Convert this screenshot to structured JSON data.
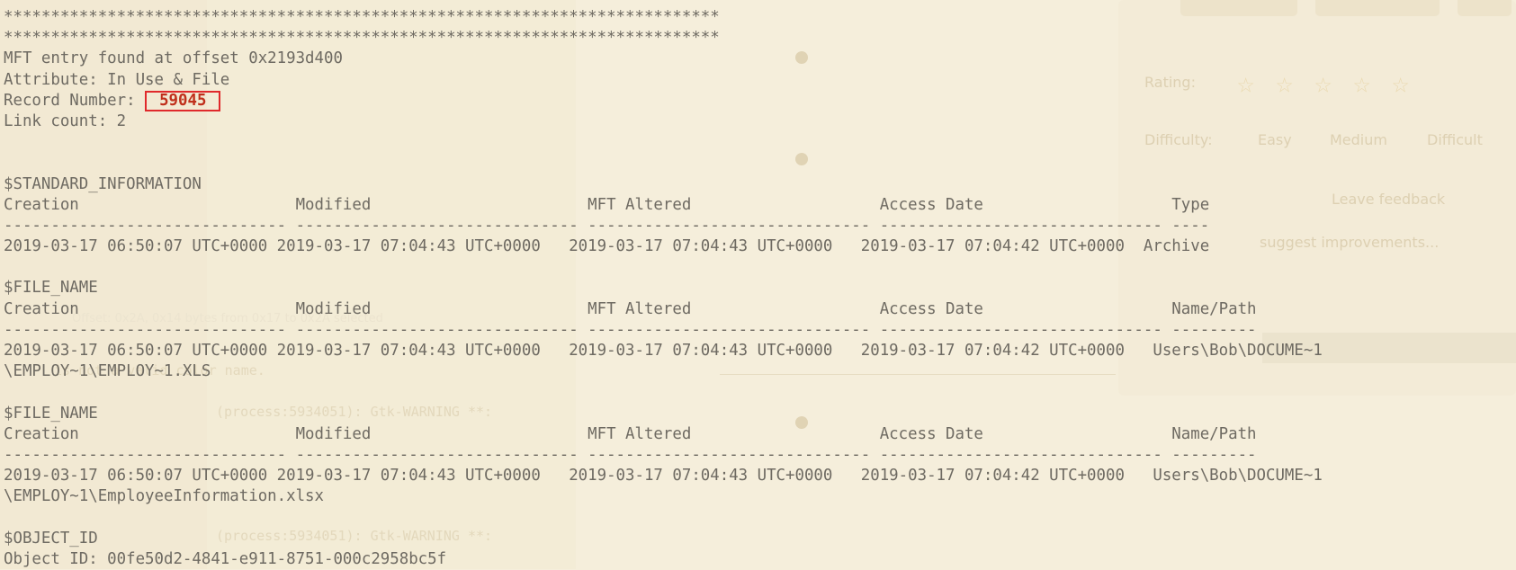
{
  "background": {
    "rating_label": "Rating:",
    "difficulty_label": "Difficulty:",
    "difficulty_options": [
      "Easy",
      "Medium",
      "Difficult"
    ],
    "feedback_text": "Leave feedback",
    "suggest_text": "suggest improvements...",
    "offset_status": "Offset: 0x2A, 0x14 bytes from 0x17 to 0x2A selected",
    "gtk_warning": "(process:5934051): Gtk-WARNING **:",
    "color_name_note": "is not a valid color name.",
    "colors": {
      "background": "#f5eedb",
      "text": "#6e6a62",
      "highlight_border": "#e0292b",
      "highlight_text": "#c0301c"
    }
  },
  "terminal": {
    "separator": "****************************************************************************",
    "entry_found": "MFT entry found at offset 0x2193d400",
    "attribute": "Attribute: In Use & File",
    "record_label": "Record Number: ",
    "record_number": "59045",
    "link_count": "Link count: 2",
    "std_info": {
      "title": "$STANDARD_INFORMATION",
      "header": "Creation                       Modified                       MFT Altered                    Access Date                    Type",
      "dashes": "------------------------------ ------------------------------ ------------------------------ ------------------------------ ----",
      "row": "2019-03-17 06:50:07 UTC+0000 2019-03-17 07:04:43 UTC+0000   2019-03-17 07:04:43 UTC+0000   2019-03-17 07:04:42 UTC+0000  Archive"
    },
    "file_name_1": {
      "title": "$FILE_NAME",
      "header": "Creation                       Modified                       MFT Altered                    Access Date                    Name/Path",
      "dashes": "------------------------------ ------------------------------ ------------------------------ ------------------------------ ---------",
      "row": "2019-03-17 06:50:07 UTC+0000 2019-03-17 07:04:43 UTC+0000   2019-03-17 07:04:43 UTC+0000   2019-03-17 07:04:42 UTC+0000   Users\\Bob\\DOCUME~1",
      "row_cont": "\\EMPLOY~1\\EMPLOY~1.XLS"
    },
    "file_name_2": {
      "title": "$FILE_NAME",
      "header": "Creation                       Modified                       MFT Altered                    Access Date                    Name/Path",
      "dashes": "------------------------------ ------------------------------ ------------------------------ ------------------------------ ---------",
      "row": "2019-03-17 06:50:07 UTC+0000 2019-03-17 07:04:43 UTC+0000   2019-03-17 07:04:43 UTC+0000   2019-03-17 07:04:42 UTC+0000   Users\\Bob\\DOCUME~1",
      "row_cont": "\\EMPLOY~1\\EmployeeInformation.xlsx"
    },
    "object_id": {
      "title": "$OBJECT_ID",
      "value": "Object ID: 00fe50d2-4841-e911-8751-000c2958bc5f"
    }
  }
}
